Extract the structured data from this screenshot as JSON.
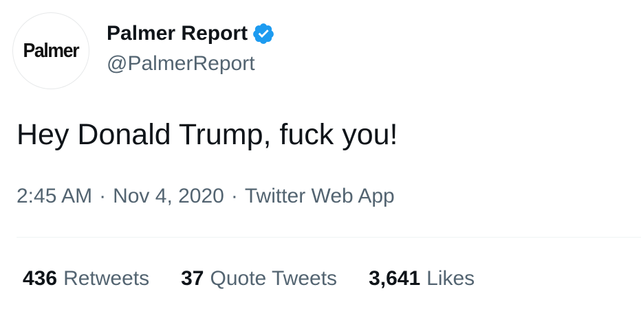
{
  "account": {
    "avatar_text": "Palmer",
    "display_name": "Palmer Report",
    "handle": "@PalmerReport",
    "verified": true,
    "verified_icon": "verified-badge-icon"
  },
  "tweet": {
    "text": "Hey Donald Trump, fuck you!",
    "time": "2:45 AM",
    "date": "Nov 4, 2020",
    "source": "Twitter Web App",
    "separator": "·"
  },
  "stats": {
    "retweets_count": "436",
    "retweets_label": "Retweets",
    "quotes_count": "37",
    "quotes_label": "Quote Tweets",
    "likes_count": "3,641",
    "likes_label": "Likes"
  },
  "colors": {
    "text_primary": "#0f1419",
    "text_secondary": "#536471",
    "verified_blue": "#1d9bf0",
    "divider": "#eff3f4"
  }
}
